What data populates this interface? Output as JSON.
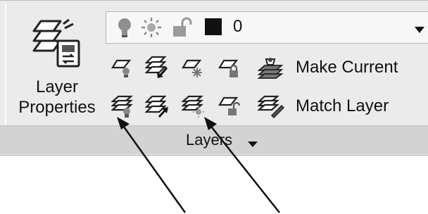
{
  "panel": {
    "title": "Layers"
  },
  "layer_properties_button": {
    "label_line1": "Layer",
    "label_line2": "Properties"
  },
  "layer_combo": {
    "value": "0",
    "state_icons": [
      "lightbulb-on-icon",
      "sun-thaw-icon",
      "unlock-icon"
    ],
    "color_swatch": "#111111"
  },
  "tools": {
    "row1": [
      "layer-off-icon",
      "layer-isolate-icon",
      "layer-freeze-icon",
      "layer-lock-icon",
      "make-current-icon"
    ],
    "row2": [
      "layer-on-icon",
      "unisolate-icon",
      "thaw-all-icon",
      "layer-unlock-icon",
      "match-layer-icon"
    ],
    "make_current_label": "Make Current",
    "match_layer_label": "Match Layer"
  },
  "annotation": {
    "type": "arrows",
    "count": 2,
    "color": "#111111"
  }
}
